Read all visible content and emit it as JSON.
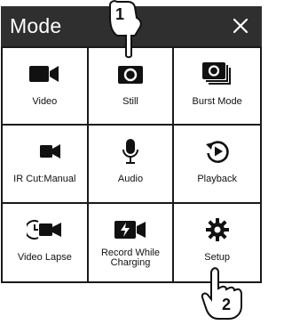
{
  "header": {
    "title": "Mode",
    "close_icon": "close-icon"
  },
  "items": [
    {
      "label": "Video",
      "icon": "video-camera-icon"
    },
    {
      "label": "Still",
      "icon": "still-camera-icon"
    },
    {
      "label": "Burst Mode",
      "icon": "burst-mode-icon"
    },
    {
      "label": "IR Cut:Manual",
      "icon": "ir-cut-icon"
    },
    {
      "label": "Audio",
      "icon": "microphone-icon"
    },
    {
      "label": "Playback",
      "icon": "playback-icon"
    },
    {
      "label": "Video Lapse",
      "icon": "video-lapse-icon"
    },
    {
      "label_line1": "Record While",
      "label_line2": "Charging",
      "icon": "record-while-charging-icon"
    },
    {
      "label": "Setup",
      "icon": "gear-icon"
    }
  ],
  "callouts": {
    "step1": "1",
    "step2": "2"
  },
  "colors": {
    "header_bg": "#2f2f2f",
    "header_text": "#ffffff",
    "icon": "#111111"
  }
}
